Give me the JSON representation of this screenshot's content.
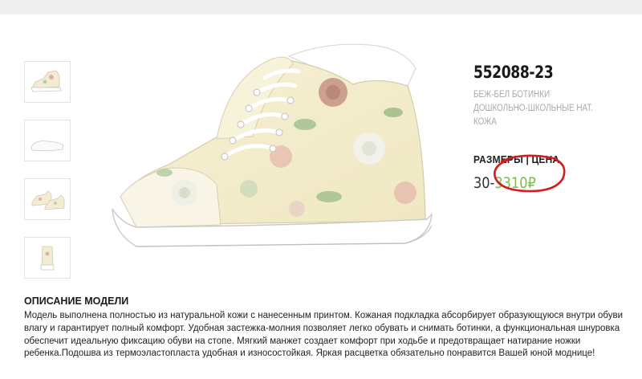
{
  "product": {
    "article": "552088-23",
    "subtitle": "БЕЖ-БЕЛ БОТИНКИ ДОШКОЛЬНО-ШКОЛЬНЫЕ НАТ. КОЖА",
    "sizes_header": "РАЗМЕРЫ | ЦЕНА",
    "size": "30",
    "dash": "-",
    "price": "3310₽"
  },
  "thumbnails": [
    "shoe-side-view",
    "shoe-sole-view",
    "shoe-pair-view",
    "shoe-back-view"
  ],
  "description": {
    "title": "ОПИСАНИЕ МОДЕЛИ",
    "text": "Модель выполнена полностью из натуральной кожи с нанесенным принтом. Кожаная подкладка абсорбирует образующуюся внутри обуви влагу и гарантирует полный комфорт. Удобная застежка-молния позволяет легко обувать и снимать ботинки, а функциональная шнуровка обеспечит идеальную фиксацию обуви на стопе. Мягкий манжет создает комфорт при ходьбе и предотвращает натирание ножки ребенка.Подошва из термоэластопласта удобная и износостойкая. Яркая расцветка обязательно понравится Вашей юной моднице!"
  },
  "colors": {
    "price": "#7cbc4c",
    "annotation_circle": "#d61c1c",
    "sole": "#ffffff",
    "upper": "#f5efcc"
  }
}
